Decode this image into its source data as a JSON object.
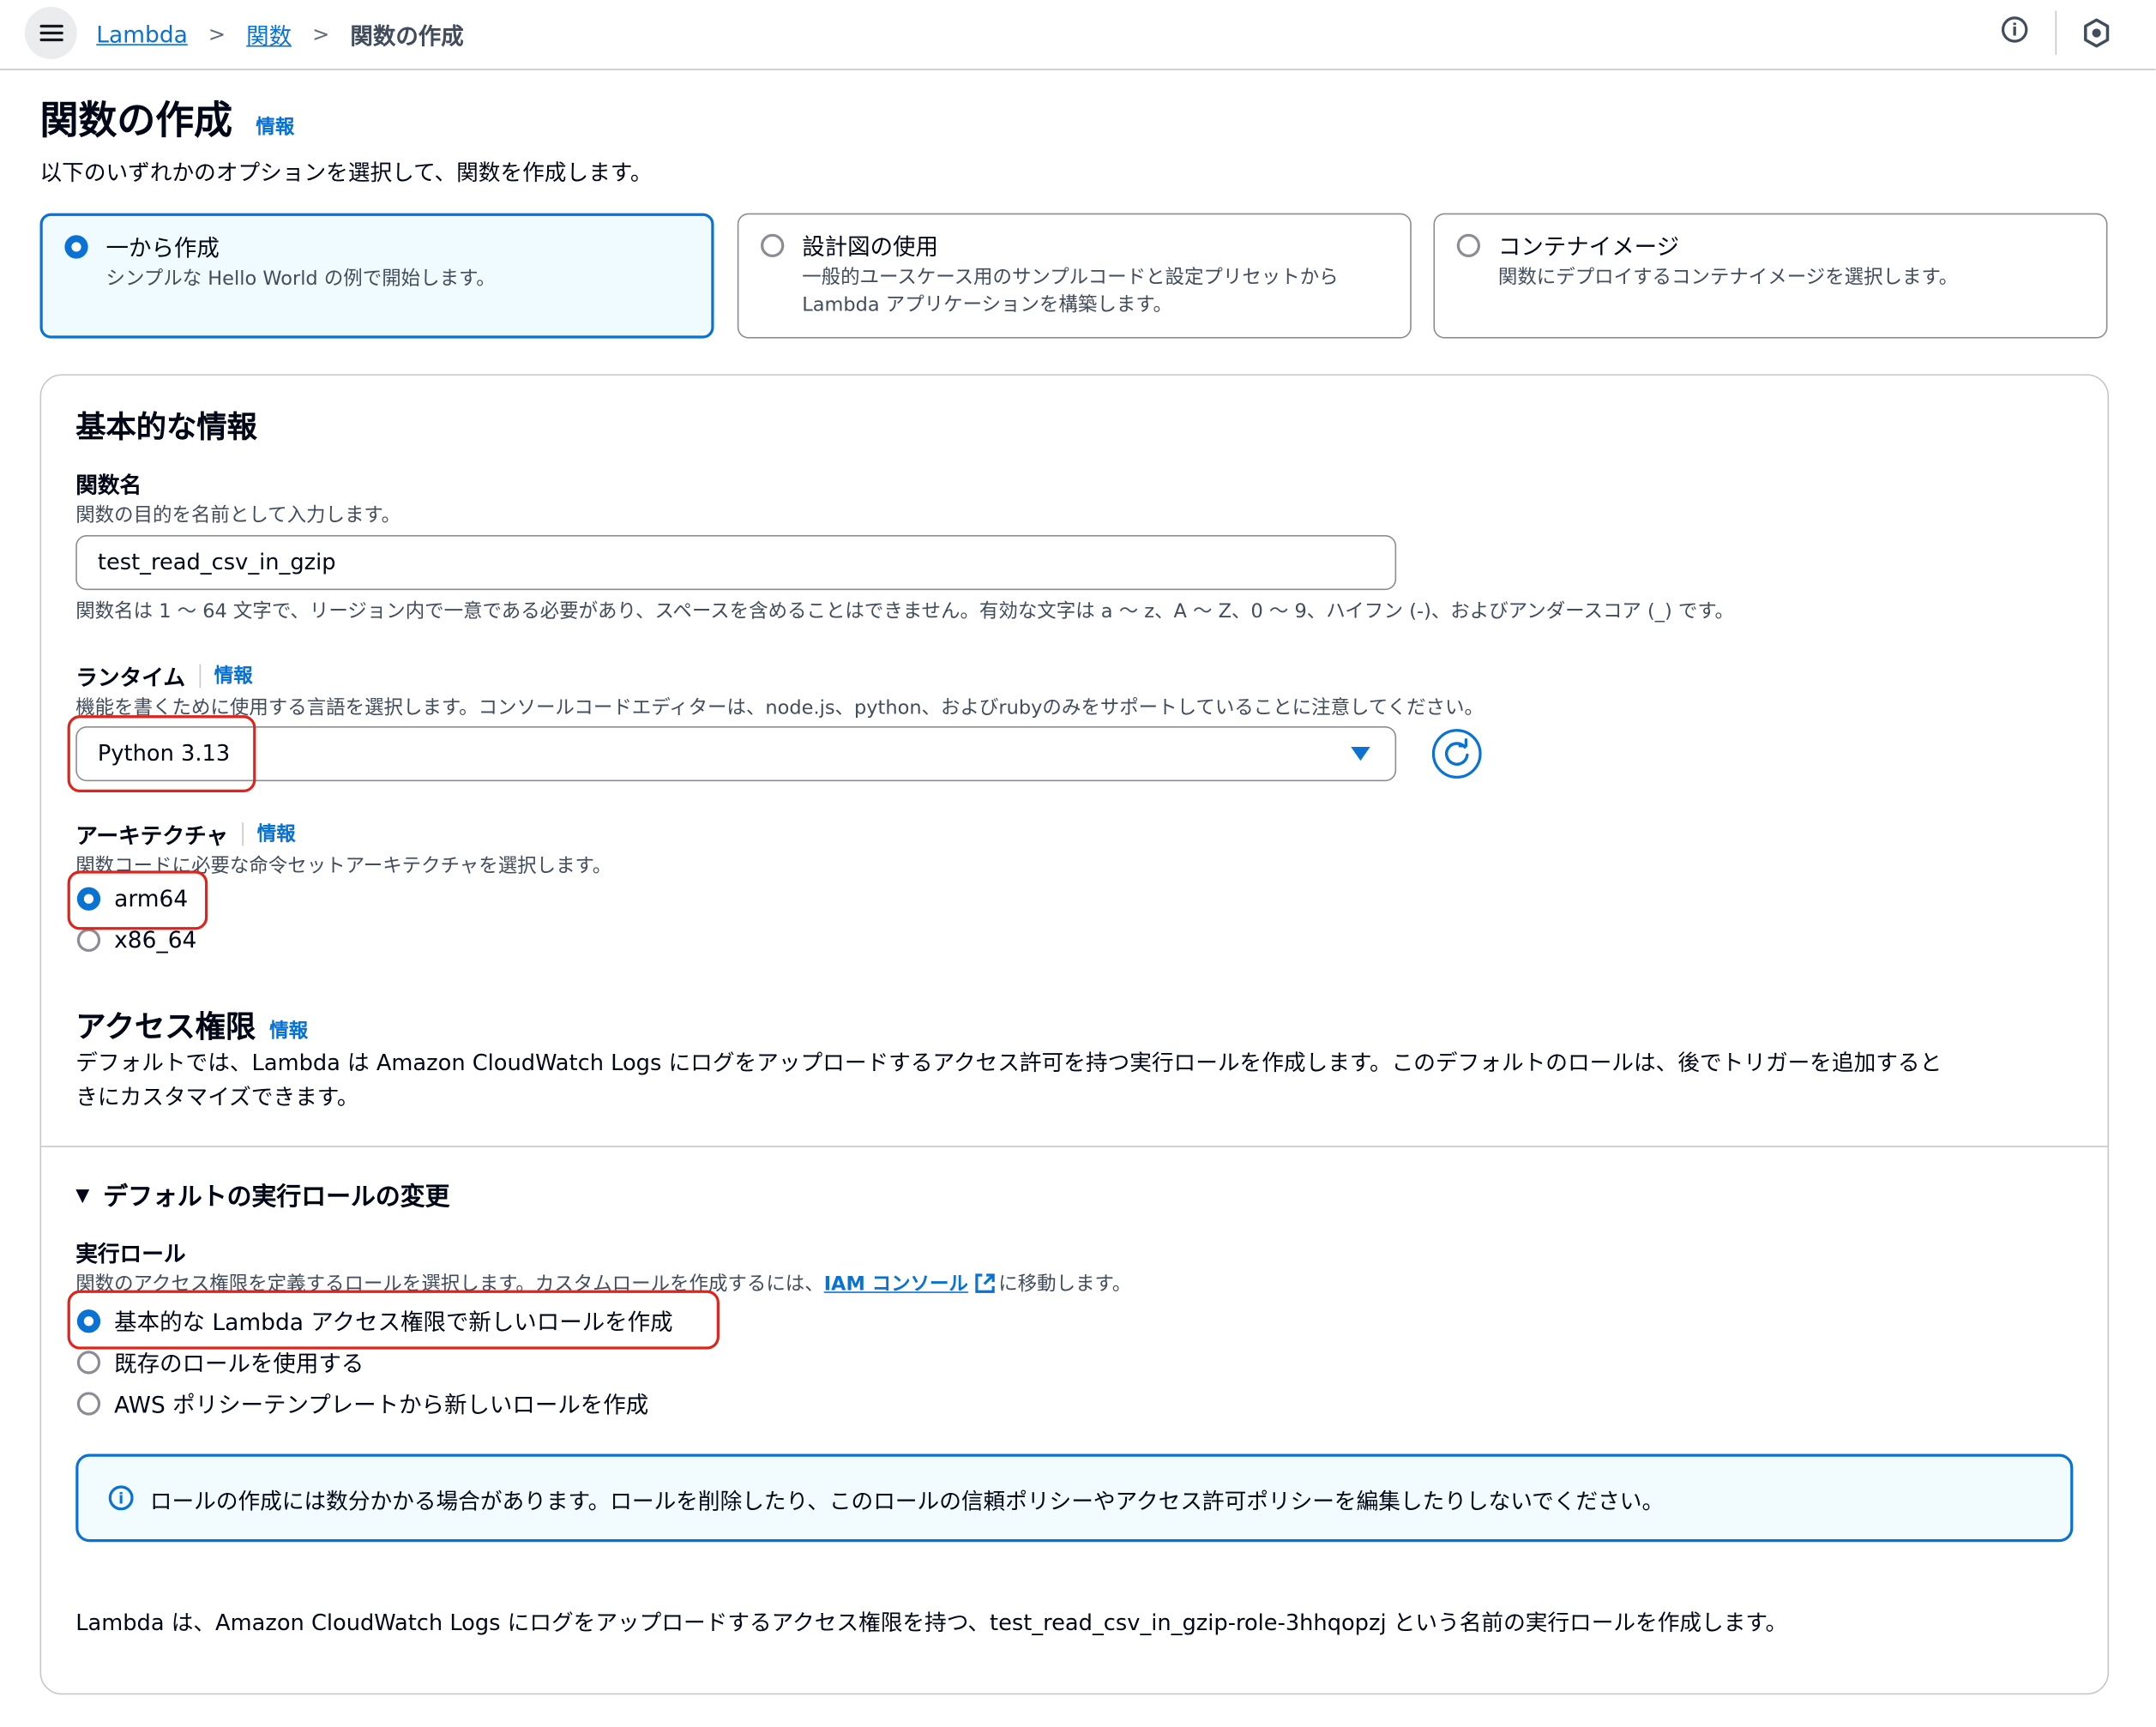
{
  "breadcrumb": {
    "root": "Lambda",
    "functions": "関数",
    "current": "関数の作成"
  },
  "page": {
    "title": "関数の作成",
    "info": "情報",
    "subtitle": "以下のいずれかのオプションを選択して、関数を作成します。"
  },
  "create_options": [
    {
      "title": "一から作成",
      "desc": "シンプルな Hello World の例で開始します。",
      "selected": true
    },
    {
      "title": "設計図の使用",
      "desc": "一般的ユースケース用のサンプルコードと設定プリセットから Lambda アプリケーションを構築します。",
      "selected": false
    },
    {
      "title": "コンテナイメージ",
      "desc": "関数にデプロイするコンテナイメージを選択します。",
      "selected": false
    }
  ],
  "basic": {
    "heading": "基本的な情報",
    "function_name": {
      "label": "関数名",
      "desc": "関数の目的を名前として入力します。",
      "value": "test_read_csv_in_gzip",
      "hint": "関数名は 1 ～ 64 文字で、リージョン内で一意である必要があり、スペースを含めることはできません。有効な文字は a ～ z、A ～ Z、0 ～ 9、ハイフン (-)、およびアンダースコア (_) です。"
    },
    "runtime": {
      "label": "ランタイム",
      "info": "情報",
      "desc": "機能を書くために使用する言語を選択します。コンソールコードエディターは、node.js、python、およびrubyのみをサポートしていることに注意してください。",
      "value": "Python 3.13"
    },
    "architecture": {
      "label": "アーキテクチャ",
      "info": "情報",
      "desc": "関数コードに必要な命令セットアーキテクチャを選択します。",
      "options": [
        "arm64",
        "x86_64"
      ],
      "selected": "arm64"
    }
  },
  "access": {
    "heading": "アクセス権限",
    "info": "情報",
    "desc_line1": "デフォルトでは、Lambda は Amazon CloudWatch Logs にログをアップロードするアクセス許可を持つ実行ロールを作成します。このデフォルトのロールは、後でトリガーを追加すると",
    "desc_line2": "きにカスタマイズできます。"
  },
  "role_section": {
    "toggle_label": "デフォルトの実行ロールの変更",
    "exec_role_label": "実行ロール",
    "desc_before": "関数のアクセス権限を定義するロールを選択します。カスタムロールを作成するには、",
    "desc_link": "IAM コンソール",
    "desc_after": "に移動します。",
    "options": [
      "基本的な Lambda アクセス権限で新しいロールを作成",
      "既存のロールを使用する",
      "AWS ポリシーテンプレートから新しいロールを作成"
    ],
    "selected_index": 0,
    "alert": "ロールの作成には数分かかる場合があります。ロールを削除したり、このロールの信頼ポリシーやアクセス許可ポリシーを編集したりしないでください。",
    "footer": "Lambda は、Amazon CloudWatch Logs にログをアップロードするアクセス権限を持つ、test_read_csv_in_gzip-role-3hhqopzj という名前の実行ロールを作成します。"
  },
  "colors": {
    "accent": "#0972d3",
    "highlight": "#e0241b",
    "border": "#8c8c94"
  }
}
